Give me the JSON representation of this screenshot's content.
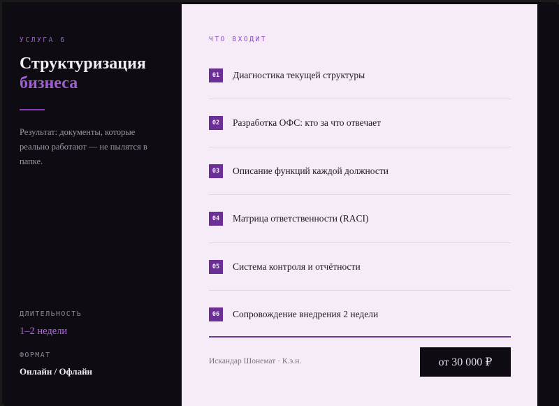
{
  "left": {
    "eyebrow": "УСЛУГА 6",
    "title_line1": "Структуризация",
    "title_line2": "бизнеса",
    "description": "Результат: документы, которые реально работают — не пылятся в папке.",
    "duration_label": "ДЛИТЕЛЬНОСТЬ",
    "duration_value": "1–2 недели",
    "format_label": "ФОРМАТ",
    "format_value": "Онлайн / Офлайн"
  },
  "right": {
    "eyebrow": "ЧТО ВХОДИТ",
    "items": [
      {
        "num": "01",
        "label": "Диагностика текущей структуры"
      },
      {
        "num": "02",
        "label": "Разработка ОФС: кто за что отвечает"
      },
      {
        "num": "03",
        "label": "Описание функций каждой должности"
      },
      {
        "num": "04",
        "label": "Матрица ответственности (RACI)"
      },
      {
        "num": "05",
        "label": "Система контроля и отчётности"
      },
      {
        "num": "06",
        "label": "Сопровождение внедрения 2 недели"
      }
    ],
    "author": "Искандар Шонемат · К.э.н.",
    "price": "от 30 000 ₽"
  },
  "colors": {
    "accent": "#a05fd0",
    "dark_bg": "#0e0b12",
    "light_bg": "#f5ecf8",
    "badge": "#6b2f95"
  }
}
